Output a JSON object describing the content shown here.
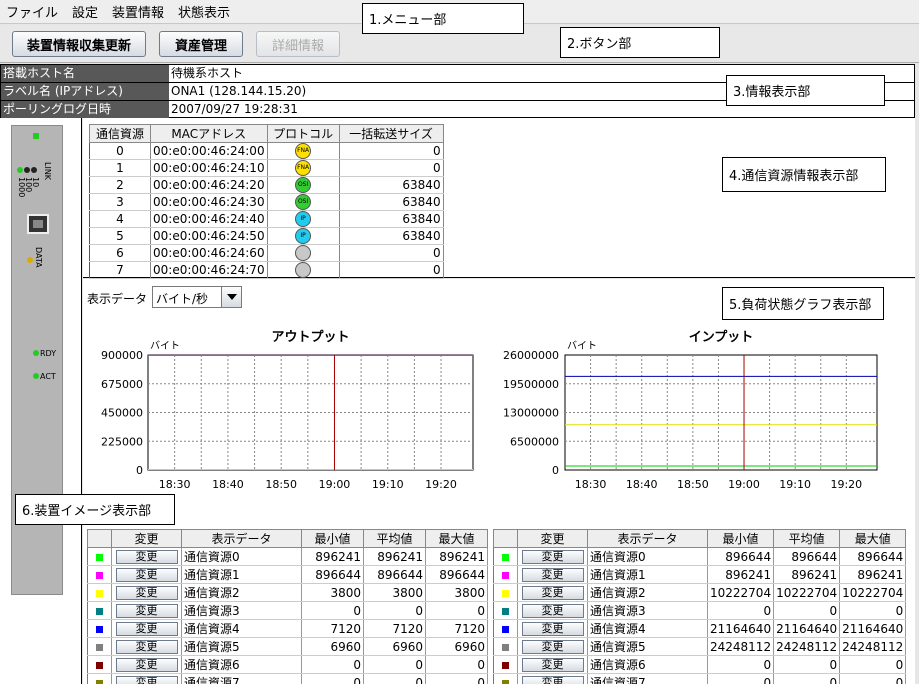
{
  "menu": [
    "ファイル",
    "設定",
    "装置情報",
    "状態表示"
  ],
  "buttons": {
    "collect": "装置情報収集更新",
    "asset": "資産管理",
    "detail": "詳細情報"
  },
  "callouts": {
    "c1": "1.メニュー部",
    "c2": "2.ボタン部",
    "c3": "3.情報表示部",
    "c4": "4.通信資源情報表示部",
    "c5": "5.負荷状態グラフ表示部",
    "c6": "6.装置イメージ表示部"
  },
  "info": [
    {
      "label": "搭載ホスト名",
      "value": "待機系ホスト"
    },
    {
      "label": "ラベル名 (IPアドレス)",
      "value": "ONA1 (128.144.15.20)"
    },
    {
      "label": "ポーリングログ日時",
      "value": "2007/09/27 19:28:31"
    }
  ],
  "device": {
    "link": "LINK",
    "speed": [
      "1000",
      "100",
      "10"
    ],
    "data": "DATA",
    "rdy": "RDY",
    "act": "ACT"
  },
  "resources": {
    "headers": [
      "通信資源",
      "MACアドレス",
      "プロトコル",
      "一括転送サイズ"
    ],
    "rows": [
      {
        "id": "0",
        "mac": "00:e0:00:46:24:00",
        "proto": "FNA",
        "color": "#ffe000",
        "size": "0"
      },
      {
        "id": "1",
        "mac": "00:e0:00:46:24:10",
        "proto": "FNA",
        "color": "#ffe000",
        "size": "0"
      },
      {
        "id": "2",
        "mac": "00:e0:00:46:24:20",
        "proto": "OSI",
        "color": "#33cc33",
        "size": "63840"
      },
      {
        "id": "3",
        "mac": "00:e0:00:46:24:30",
        "proto": "OSI",
        "color": "#33cc33",
        "size": "63840"
      },
      {
        "id": "4",
        "mac": "00:e0:00:46:24:40",
        "proto": "IP",
        "color": "#22ccee",
        "size": "63840"
      },
      {
        "id": "5",
        "mac": "00:e0:00:46:24:50",
        "proto": "IP",
        "color": "#22ccee",
        "size": "63840"
      },
      {
        "id": "6",
        "mac": "00:e0:00:46:24:60",
        "proto": "",
        "color": "#c8c8c8",
        "size": "0"
      },
      {
        "id": "7",
        "mac": "00:e0:00:46:24:70",
        "proto": "",
        "color": "#c8c8c8",
        "size": "0"
      }
    ]
  },
  "display_data": {
    "label": "表示データ",
    "selected": "バイト/秒"
  },
  "chart_data": [
    {
      "type": "line",
      "title": "アウトプット",
      "ylabel": "バイト",
      "yticks": [
        "900000",
        "675000",
        "450000",
        "225000",
        "0"
      ],
      "ylim": [
        0,
        900000
      ],
      "xticks": [
        "18:30",
        "18:40",
        "18:50",
        "19:00",
        "19:10",
        "19:20"
      ],
      "cursor": "19:00",
      "series": [
        {
          "values": [
            896644,
            896644
          ],
          "color": "#cc00cc"
        },
        {
          "values": [
            896241,
            896241
          ],
          "color": "#00cc00"
        },
        {
          "values": [
            3800,
            3800
          ],
          "color": "#e0e000"
        }
      ]
    },
    {
      "type": "line",
      "title": "インプット",
      "ylabel": "バイト",
      "yticks": [
        "26000000",
        "19500000",
        "13000000",
        "6500000",
        "0"
      ],
      "ylim": [
        0,
        26000000
      ],
      "xticks": [
        "18:30",
        "18:40",
        "18:50",
        "19:00",
        "19:10",
        "19:20"
      ],
      "cursor": "19:00",
      "series": [
        {
          "values": [
            21164640,
            21164640
          ],
          "color": "#0000aa"
        },
        {
          "values": [
            10222704,
            10222704
          ],
          "color": "#e0e000"
        },
        {
          "values": [
            896644,
            896644
          ],
          "color": "#00cc00"
        }
      ]
    }
  ],
  "stats_headers": [
    "変更",
    "表示データ",
    "最小値",
    "平均値",
    "最大値"
  ],
  "change_label": "変更",
  "stats_left": [
    {
      "color": "#00ff00",
      "name": "通信資源0",
      "min": "896241",
      "avg": "896241",
      "max": "896241"
    },
    {
      "color": "#ff00ff",
      "name": "通信資源1",
      "min": "896644",
      "avg": "896644",
      "max": "896644"
    },
    {
      "color": "#ffff00",
      "name": "通信資源2",
      "min": "3800",
      "avg": "3800",
      "max": "3800"
    },
    {
      "color": "#008080",
      "name": "通信資源3",
      "min": "0",
      "avg": "0",
      "max": "0"
    },
    {
      "color": "#0000ff",
      "name": "通信資源4",
      "min": "7120",
      "avg": "7120",
      "max": "7120"
    },
    {
      "color": "#808080",
      "name": "通信資源5",
      "min": "6960",
      "avg": "6960",
      "max": "6960"
    },
    {
      "color": "#800000",
      "name": "通信資源6",
      "min": "0",
      "avg": "0",
      "max": "0"
    },
    {
      "color": "#808000",
      "name": "通信資源7",
      "min": "0",
      "avg": "0",
      "max": "0"
    }
  ],
  "stats_right": [
    {
      "color": "#00ff00",
      "name": "通信資源0",
      "min": "896644",
      "avg": "896644",
      "max": "896644"
    },
    {
      "color": "#ff00ff",
      "name": "通信資源1",
      "min": "896241",
      "avg": "896241",
      "max": "896241"
    },
    {
      "color": "#ffff00",
      "name": "通信資源2",
      "min": "10222704",
      "avg": "10222704",
      "max": "10222704"
    },
    {
      "color": "#008080",
      "name": "通信資源3",
      "min": "0",
      "avg": "0",
      "max": "0"
    },
    {
      "color": "#0000ff",
      "name": "通信資源4",
      "min": "21164640",
      "avg": "21164640",
      "max": "21164640"
    },
    {
      "color": "#808080",
      "name": "通信資源5",
      "min": "24248112",
      "avg": "24248112",
      "max": "24248112"
    },
    {
      "color": "#800000",
      "name": "通信資源6",
      "min": "0",
      "avg": "0",
      "max": "0"
    },
    {
      "color": "#808000",
      "name": "通信資源7",
      "min": "0",
      "avg": "0",
      "max": "0"
    }
  ]
}
